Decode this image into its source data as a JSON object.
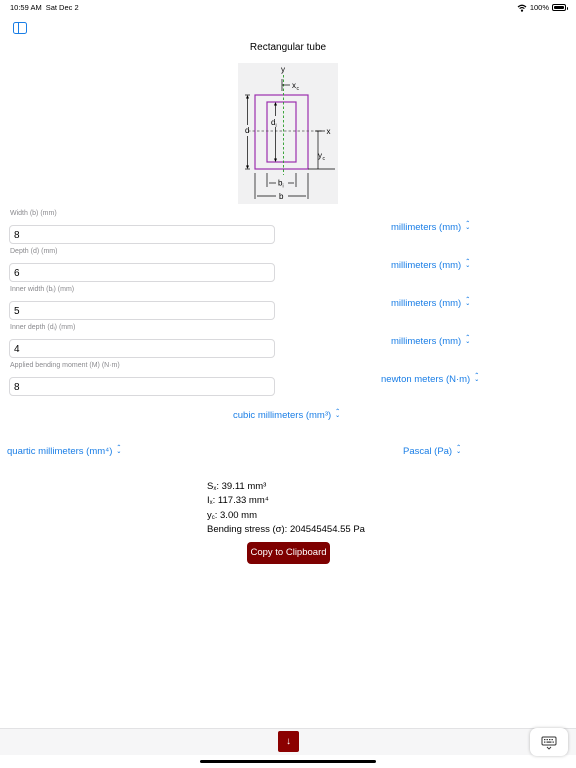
{
  "status_bar": {
    "time": "10:59 AM",
    "date": "Sat Dec 2",
    "battery": "100%"
  },
  "page": {
    "title": "Rectangular tube"
  },
  "diagram": {
    "y": "y",
    "xc": "x",
    "xc_sub": "c",
    "d": "d",
    "di": "d",
    "di_sub": "i",
    "x": "x",
    "yc": "y",
    "yc_sub": "c",
    "bi": "b",
    "bi_sub": "i",
    "b": "b"
  },
  "fields": [
    {
      "label": "Width (b) (mm)",
      "value": "8",
      "unit": "millimeters (mm)"
    },
    {
      "label": "Depth (d) (mm)",
      "value": "6",
      "unit": "millimeters (mm)"
    },
    {
      "label": "Inner width (bᵢ) (mm)",
      "value": "5",
      "unit": "millimeters (mm)"
    },
    {
      "label": "Inner depth (dᵢ) (mm)",
      "value": "4",
      "unit": "millimeters (mm)"
    },
    {
      "label": "Applied bending moment (M) (N·m)",
      "value": "8",
      "unit": "newton meters (N·m)"
    }
  ],
  "units": {
    "section_modulus": "cubic millimeters (mm³)",
    "moment_of_inertia": "quartic millimeters (mm⁴)",
    "stress": "Pascal (Pa)"
  },
  "results": {
    "sx_label": "S",
    "sx_sub": "x",
    "sx_value": ": 39.11 mm³",
    "ix_label": "I",
    "ix_sub": "x",
    "ix_value": ": 117.33 mm⁴",
    "yc_label": "y",
    "yc_sub": "c",
    "yc_value": ": 3.00  mm",
    "stress": "Bending stress (σ): 204545454.55  Pa"
  },
  "copy_button": "Copy to Clipboard",
  "colors": {
    "accent": "#1a7ee6",
    "button": "#7e0000",
    "section": "#9b2fae",
    "axis": "#2a9d2a"
  },
  "icons": [
    "sidebar-icon",
    "wifi-icon",
    "battery-icon",
    "chevron-updown-icon",
    "arrow-down-icon",
    "keyboard-icon"
  ]
}
